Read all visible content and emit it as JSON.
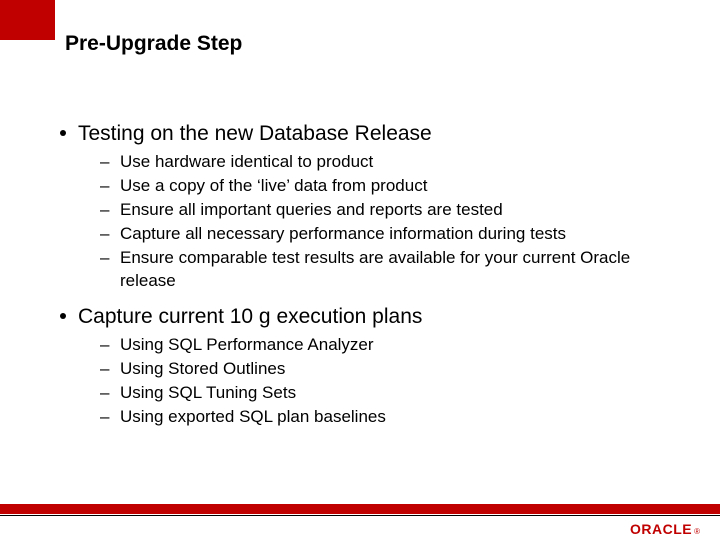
{
  "title": "Pre-Upgrade Step",
  "bullets": [
    {
      "text": "Testing on the new Database Release",
      "sub": [
        "Use hardware identical to product",
        "Use a copy of the ‘live’ data from product",
        "Ensure all important queries and reports are tested",
        "Capture all necessary performance information during tests",
        "Ensure comparable test results are available for your current Oracle release"
      ]
    },
    {
      "text": "Capture current 10 g execution plans",
      "sub": [
        "Using SQL Performance Analyzer",
        "Using Stored Outlines",
        "Using SQL Tuning Sets",
        "Using exported SQL plan baselines"
      ]
    }
  ],
  "footer": {
    "logo": "ORACLE",
    "reg": "®"
  }
}
